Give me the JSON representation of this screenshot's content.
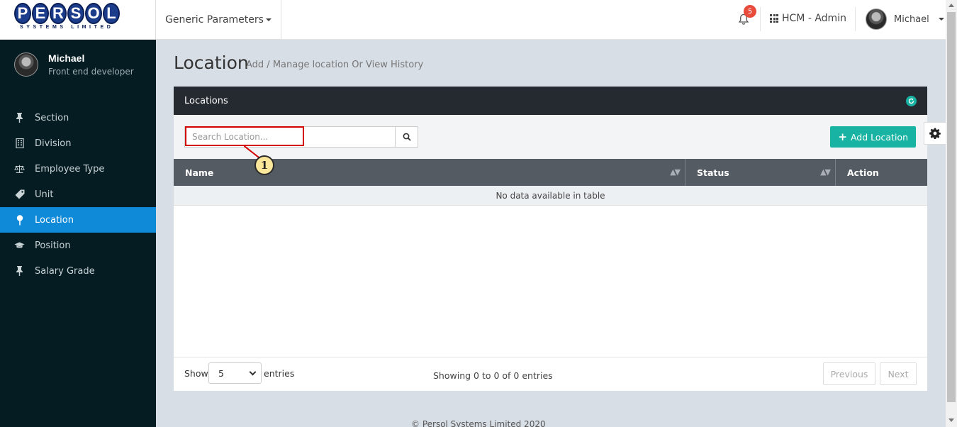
{
  "logo": {
    "letters": [
      "P",
      "E",
      "R",
      "S",
      "O",
      "L"
    ],
    "tagline": "SYSTEMS LIMITED"
  },
  "header": {
    "module_menu_label": "Generic Parameters",
    "notification_count": "5",
    "app_switch_label": "HCM - Admin",
    "user_name": "Michael"
  },
  "sidebar": {
    "profile": {
      "name": "Michael",
      "role": "Front end developer"
    },
    "items": [
      {
        "label": "Section",
        "icon": "pin-icon",
        "active": false
      },
      {
        "label": "Division",
        "icon": "building-icon",
        "active": false
      },
      {
        "label": "Employee Type",
        "icon": "balance-scale-icon",
        "active": false
      },
      {
        "label": "Unit",
        "icon": "tag-icon",
        "active": false
      },
      {
        "label": "Location",
        "icon": "location-pin-icon",
        "active": true
      },
      {
        "label": "Position",
        "icon": "graduation-cap-icon",
        "active": false
      },
      {
        "label": "Salary Grade",
        "icon": "pin-icon",
        "active": false
      }
    ]
  },
  "page": {
    "title": "Location",
    "subtitle": "Add / Manage location Or View History"
  },
  "card": {
    "title": "Locations",
    "search_placeholder": "Search Location...",
    "add_button_label": "Add Location",
    "annotation_number": "1",
    "table": {
      "columns": [
        "Name",
        "Status",
        "Action"
      ],
      "empty_message": "No data available in table"
    },
    "footer": {
      "show_label": "Show",
      "page_size": "5",
      "entries_label": "entries",
      "info": "Showing 0 to 0 of 0 entries",
      "previous_label": "Previous",
      "next_label": "Next"
    }
  },
  "copyright": "© Persol Systems Limited 2020",
  "colors": {
    "sidebar_bg": "#041c22",
    "active_nav": "#0e8ad8",
    "accent_teal": "#19b3a3",
    "card_header": "#252a30",
    "table_header": "#555b62",
    "badge_red": "#e74c3c",
    "annotation_red": "#d40000"
  }
}
